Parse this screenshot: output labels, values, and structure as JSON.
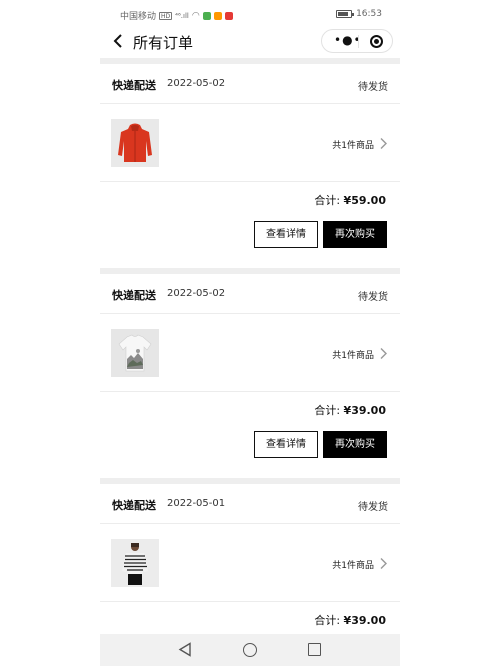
{
  "status_bar": {
    "carrier": "中国移动",
    "network_badge": "HD",
    "signal_text": "⁴⁶.ıll",
    "time": "16:53",
    "notification_colors": [
      "#4caf50",
      "#ff9800",
      "#e53935"
    ]
  },
  "header": {
    "title": "所有订单",
    "back_icon": "chevron-left-icon",
    "more_icon": "more-dots-icon",
    "close_icon": "target-circle-icon"
  },
  "orders": [
    {
      "delivery": "快递配送",
      "date": "2022-05-02",
      "status": "待发货",
      "count_text": "共1件商品",
      "total_label": "合计:",
      "total_value": "¥59.00",
      "detail_label": "查看详情",
      "rebuy_label": "再次购买",
      "product_image": "red-hooded-jacket"
    },
    {
      "delivery": "快递配送",
      "date": "2022-05-02",
      "status": "待发货",
      "count_text": "共1件商品",
      "total_label": "合计:",
      "total_value": "¥39.00",
      "detail_label": "查看详情",
      "rebuy_label": "再次购买",
      "product_image": "white-printed-tshirt"
    },
    {
      "delivery": "快递配送",
      "date": "2022-05-01",
      "status": "待发货",
      "count_text": "共1件商品",
      "total_label": "合计:",
      "total_value": "¥39.00",
      "product_image": "striped-top-model"
    }
  ],
  "colors": {
    "primary_button": "#000000",
    "divider": "#eeeeee",
    "text": "#111111"
  }
}
